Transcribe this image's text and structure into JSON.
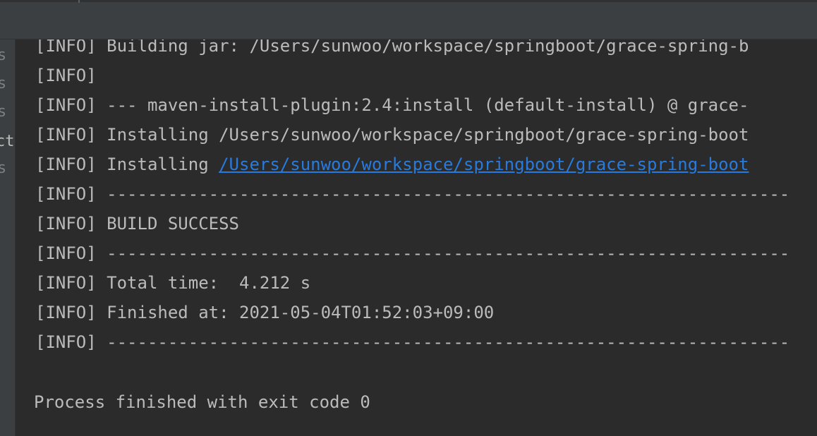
{
  "side_labels": [
    "s",
    "s",
    "s",
    "ct",
    "s"
  ],
  "log": {
    "lines": [
      {
        "tag": "[INFO]",
        "text": " Building jar: /Users/sunwoo/workspace/springboot/grace-spring-b"
      },
      {
        "tag": "[INFO]",
        "text": ""
      },
      {
        "tag": "[INFO]",
        "text": " --- maven-install-plugin:2.4:install (default-install) @ grace-"
      },
      {
        "tag": "[INFO]",
        "text": " Installing /Users/sunwoo/workspace/springboot/grace-spring-boot"
      },
      {
        "tag": "[INFO]",
        "text": " Installing ",
        "link": "/Users/sunwoo/workspace/springboot/grace-spring-boot"
      },
      {
        "tag": "[INFO]",
        "text": " -------------------------------------------------------------------"
      },
      {
        "tag": "[INFO]",
        "text": " BUILD SUCCESS"
      },
      {
        "tag": "[INFO]",
        "text": " -------------------------------------------------------------------"
      },
      {
        "tag": "[INFO]",
        "text": " Total time:  4.212 s"
      },
      {
        "tag": "[INFO]",
        "text": " Finished at: 2021-05-04T01:52:03+09:00"
      },
      {
        "tag": "[INFO]",
        "text": " -------------------------------------------------------------------"
      }
    ],
    "exit_message": "Process finished with exit code 0"
  },
  "colors": {
    "background": "#2b2b2b",
    "toolbar": "#3c3f41",
    "text": "#bbbbbb",
    "link": "#287bde"
  }
}
